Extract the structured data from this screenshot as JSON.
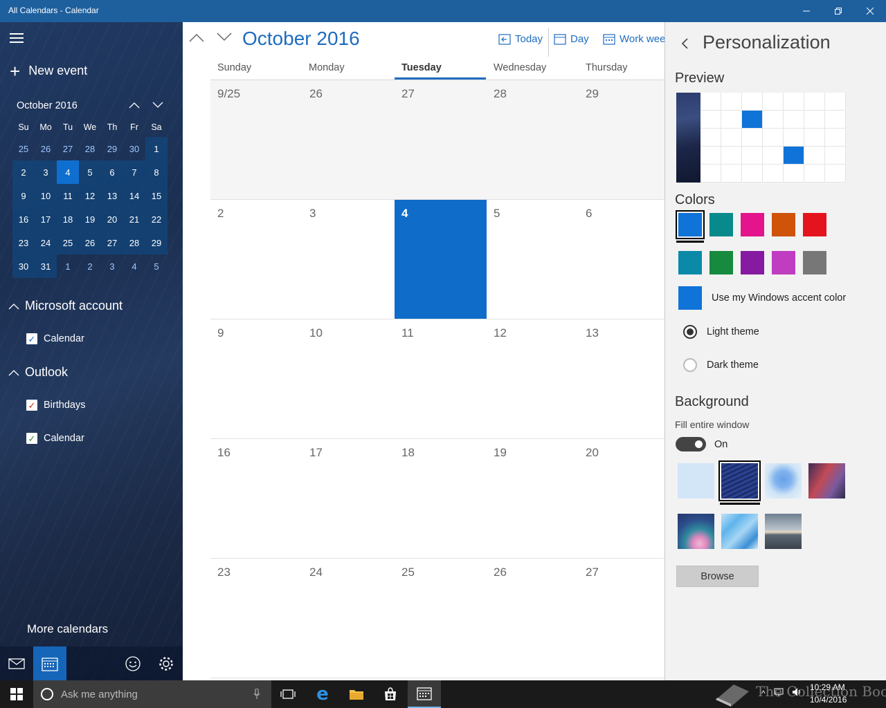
{
  "window": {
    "title": "All Calendars - Calendar"
  },
  "left": {
    "new_event": "New event",
    "mini_month": "October 2016",
    "dow": [
      "Su",
      "Mo",
      "Tu",
      "We",
      "Th",
      "Fr",
      "Sa"
    ],
    "mini_days": [
      [
        "25",
        "26",
        "27",
        "28",
        "29",
        "30",
        "1"
      ],
      [
        "2",
        "3",
        "4",
        "5",
        "6",
        "7",
        "8"
      ],
      [
        "9",
        "10",
        "11",
        "12",
        "13",
        "14",
        "15"
      ],
      [
        "16",
        "17",
        "18",
        "19",
        "20",
        "21",
        "22"
      ],
      [
        "23",
        "24",
        "25",
        "26",
        "27",
        "28",
        "29"
      ],
      [
        "30",
        "31",
        "1",
        "2",
        "3",
        "4",
        "5"
      ]
    ],
    "group_ms": "Microsoft account",
    "group_ms_cal": "Calendar",
    "group_outlook": "Outlook",
    "outlook_birthdays": "Birthdays",
    "outlook_cal": "Calendar",
    "more": "More calendars",
    "colors": {
      "birthdays_check": "#c62b1b",
      "ms_check": "#1e6cc0",
      "outlook_check": "#2a8a3a"
    }
  },
  "main": {
    "month": "October 2016",
    "views": {
      "today": "Today",
      "day": "Day",
      "workweek": "Work week"
    },
    "day_headers": [
      "Sunday",
      "Monday",
      "Tuesday",
      "Wednesday",
      "Thursday"
    ],
    "weeks": [
      [
        "9/25",
        "26",
        "27",
        "28",
        "29"
      ],
      [
        "2",
        "3",
        "4",
        "5",
        "6"
      ],
      [
        "9",
        "10",
        "11",
        "12",
        "13"
      ],
      [
        "16",
        "17",
        "18",
        "19",
        "20"
      ],
      [
        "23",
        "24",
        "25",
        "26",
        "27"
      ]
    ],
    "accent": "#0f6dc9"
  },
  "right": {
    "title": "Personalization",
    "preview": "Preview",
    "colors_label": "Colors",
    "palette": [
      "#0f73d8",
      "#088a8c",
      "#e3148c",
      "#cf5309",
      "#e4141e",
      "#0a8aa8",
      "#168a3e",
      "#861aa0",
      "#c03cc0",
      "#777777"
    ],
    "accent_label": "Use my Windows accent color",
    "light_theme": "Light theme",
    "dark_theme": "Dark theme",
    "background_label": "Background",
    "fill_label": "Fill entire window",
    "toggle_state": "On",
    "browse": "Browse"
  },
  "taskbar": {
    "search_placeholder": "Ask me anything",
    "time": "10:29 AM",
    "date": "10/4/2016",
    "watermark": "The Collection Book"
  }
}
